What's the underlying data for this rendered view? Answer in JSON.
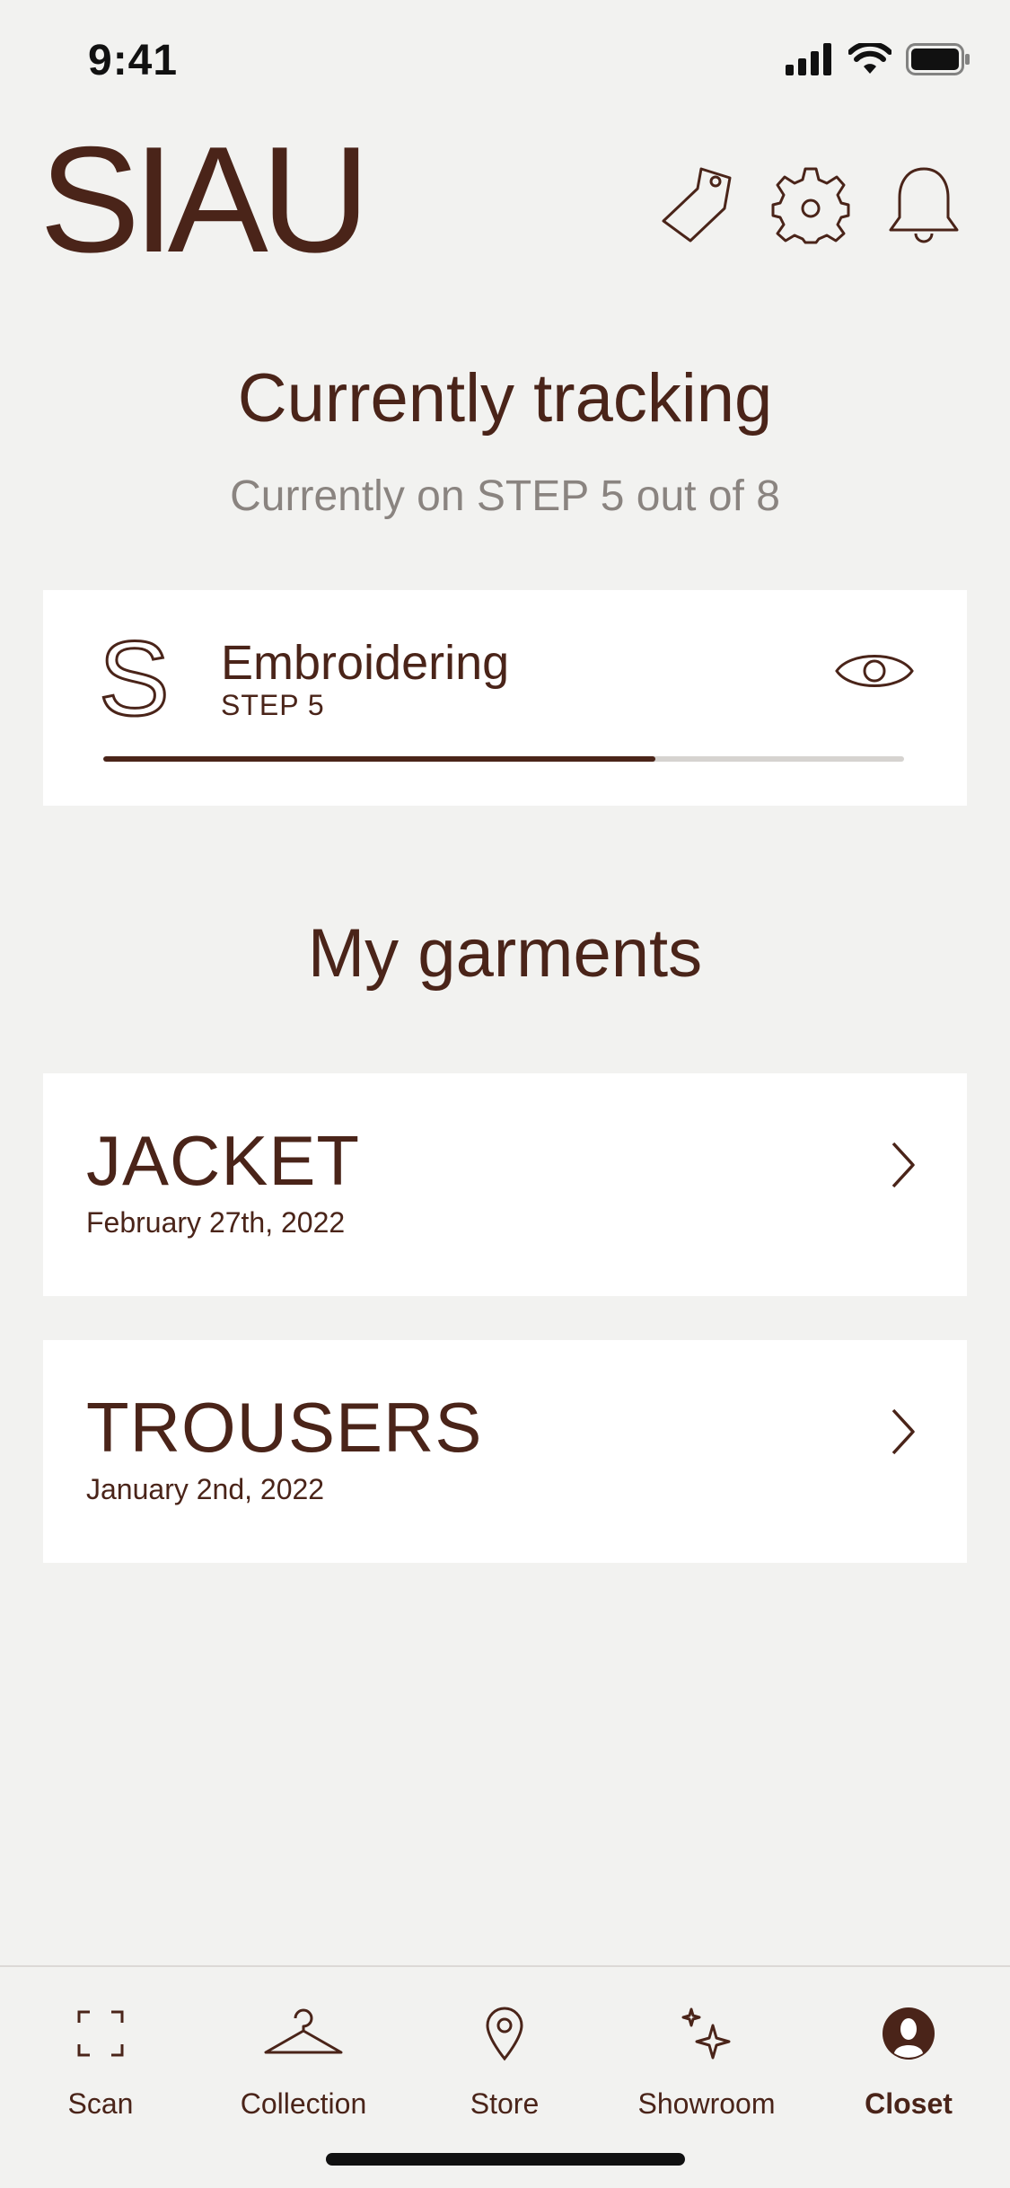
{
  "status_bar": {
    "time": "9:41"
  },
  "header": {
    "logo": "SIAU",
    "icons": [
      "tag-icon",
      "gear-icon",
      "bell-icon"
    ]
  },
  "tracking": {
    "title": "Currently tracking",
    "subtitle": "Currently on STEP 5 out of 8",
    "card": {
      "letter": "S",
      "name": "Embroidering",
      "step": "STEP 5",
      "progress": 0.69
    }
  },
  "garments": {
    "title": "My garments",
    "items": [
      {
        "name": "JACKET",
        "date": "February 27th, 2022"
      },
      {
        "name": "TROUSERS",
        "date": "January 2nd, 2022"
      }
    ]
  },
  "tabbar": {
    "items": [
      {
        "label": "Scan",
        "icon": "scan-icon",
        "active": false
      },
      {
        "label": "Collection",
        "icon": "hanger-icon",
        "active": false
      },
      {
        "label": "Store",
        "icon": "location-pin-icon",
        "active": false
      },
      {
        "label": "Showroom",
        "icon": "sparkle-icon",
        "active": false
      },
      {
        "label": "Closet",
        "icon": "profile-icon",
        "active": true
      }
    ]
  },
  "colors": {
    "brand": "#4a2419",
    "background": "#f2f2f0",
    "muted": "#8a8480",
    "card": "#ffffff"
  }
}
